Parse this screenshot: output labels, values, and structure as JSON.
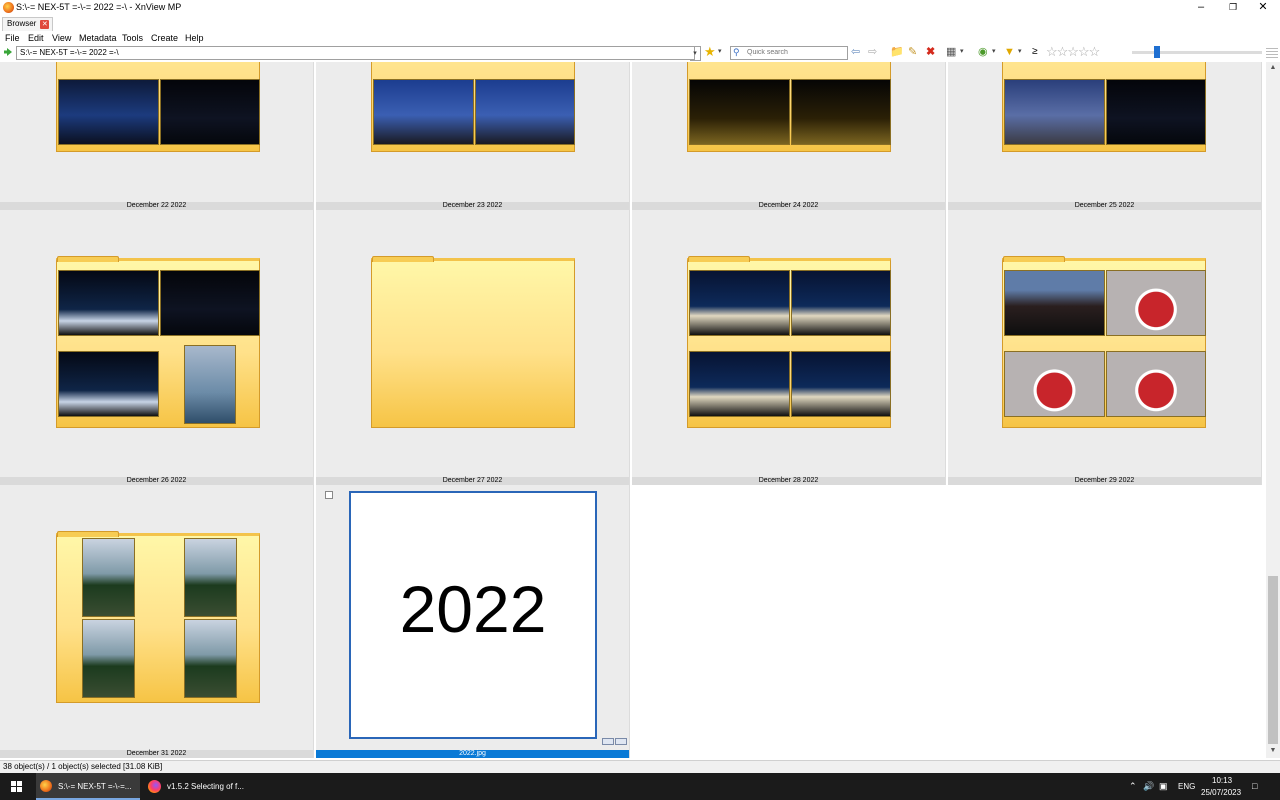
{
  "window": {
    "title": "S:\\-= NEX-5T =-\\-= 2022 =-\\ - XnView MP",
    "controls": [
      "minimize",
      "restore",
      "close"
    ]
  },
  "tabs": [
    {
      "label": "Browser",
      "closable": true
    }
  ],
  "menu": [
    "File",
    "Edit",
    "View",
    "Metadata",
    "Tools",
    "Create",
    "Help"
  ],
  "address": {
    "path": "S:\\-= NEX-5T =-\\-= 2022 =-\\",
    "search_placeholder": "Quick search"
  },
  "toolbar": {
    "filter_symbol": "≥",
    "rating_stars": "☆☆☆☆☆",
    "icons": [
      "back-icon",
      "forward-icon",
      "folder-up-icon",
      "edit-icon",
      "delete-icon",
      "view-mode-icon",
      "tag-icon",
      "filter-icon"
    ]
  },
  "grid": {
    "folders": [
      {
        "label": "December 22 2022"
      },
      {
        "label": "December 23 2022"
      },
      {
        "label": "December 24 2022"
      },
      {
        "label": "December 25 2022"
      },
      {
        "label": "December 26 2022"
      },
      {
        "label": "December 27 2022"
      },
      {
        "label": "December 28 2022"
      },
      {
        "label": "December 29 2022"
      },
      {
        "label": "December 31 2022"
      }
    ],
    "file": {
      "label": "2022.jpg",
      "preview_text": "2022",
      "selected": true
    }
  },
  "status": {
    "text": "38 object(s) / 1 object(s) selected [31.08 KiB]"
  },
  "taskbar": {
    "items": [
      {
        "label": "S:\\-= NEX-5T =-\\-=...",
        "active": true
      },
      {
        "label": "v1.5.2 Selecting of f...",
        "active": false
      }
    ],
    "tray": {
      "lang": "ENG",
      "time": "10:13",
      "date": "25/07/2023"
    }
  },
  "colors": {
    "accent": "#0a7ad6",
    "folder": "#ffe18a",
    "taskbar": "#1b1b1b"
  }
}
